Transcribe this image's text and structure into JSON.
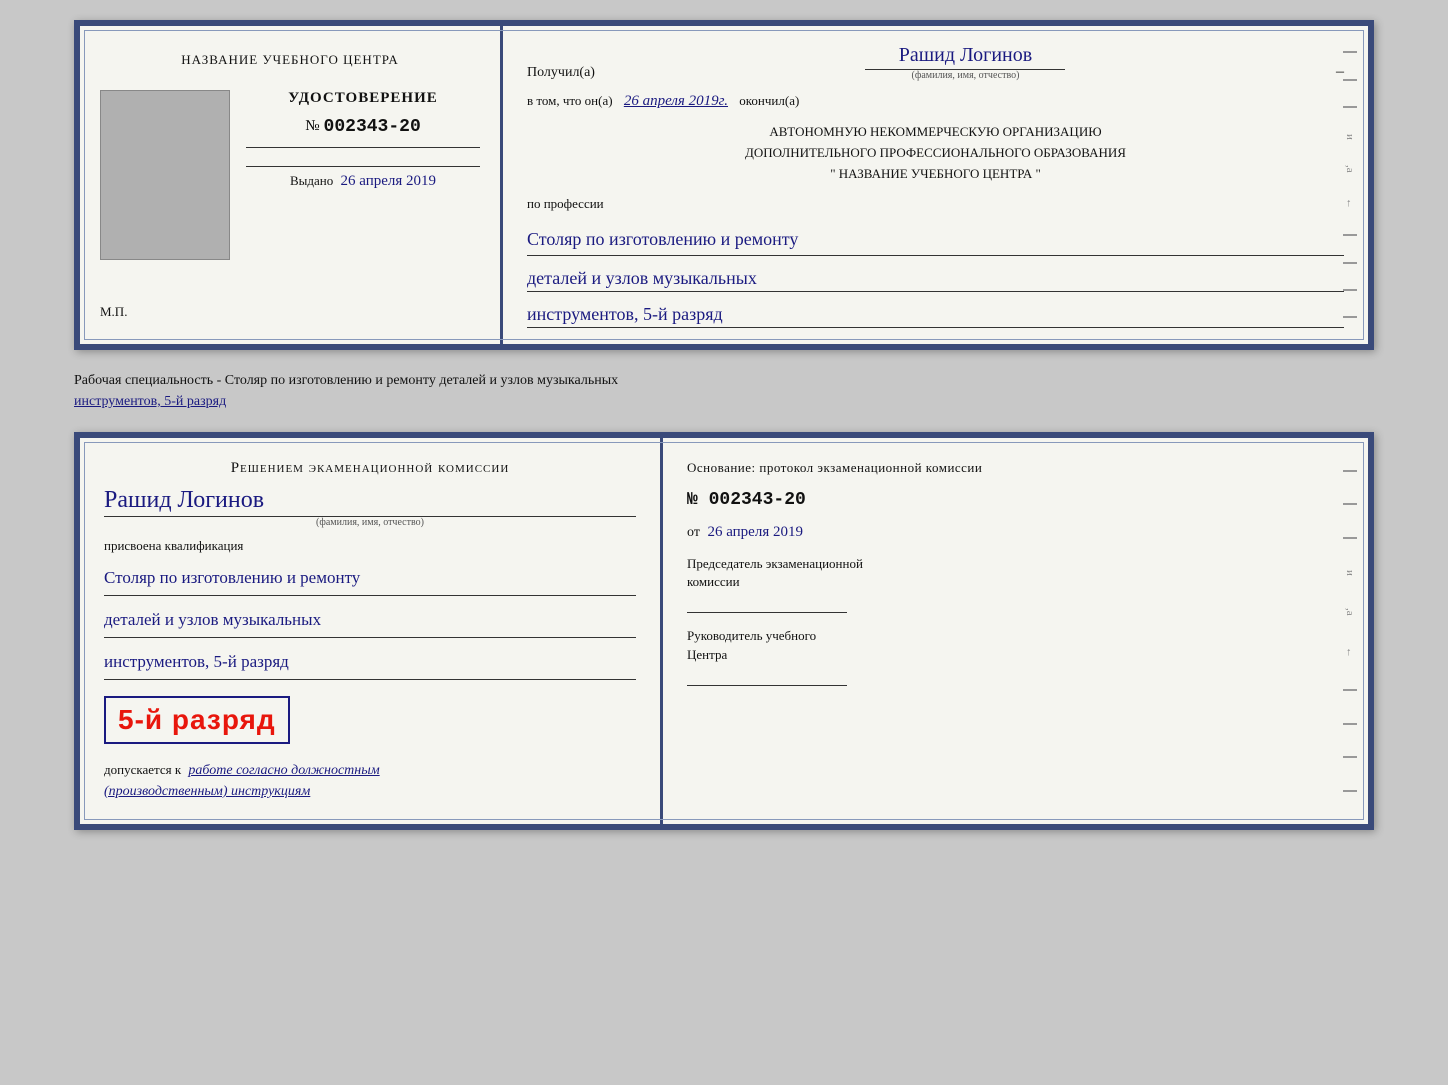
{
  "top_card": {
    "left": {
      "center_name": "НАЗВАНИЕ УЧЕБНОГО ЦЕНТРА",
      "cert_title": "УДОСТОВЕРЕНИЕ",
      "cert_number_prefix": "№",
      "cert_number": "002343-20",
      "issued_label": "Выдано",
      "issued_date": "26 апреля 2019",
      "mp_label": "М.П."
    },
    "right": {
      "received_label": "Получил(а)",
      "recipient_name": "Рашид Логинов",
      "recipient_subtitle": "(фамилия, имя, отчество)",
      "date_prefix": "в том, что он(а)",
      "date_value": "26 апреля 2019г.",
      "date_suffix": "окончил(а)",
      "org_line1": "АВТОНОМНУЮ НЕКОММЕРЧЕСКУЮ ОРГАНИЗАЦИЮ",
      "org_line2": "ДОПОЛНИТЕЛЬНОГО ПРОФЕССИОНАЛЬНОГО ОБРАЗОВАНИЯ",
      "org_line3": "\"    НАЗВАНИЕ УЧЕБНОГО ЦЕНТРА    \"",
      "profession_label": "по профессии",
      "profession_line1": "Столяр по изготовлению и ремонту",
      "profession_line2": "деталей и узлов музыкальных",
      "profession_line3": "инструментов, 5-й разряд"
    }
  },
  "between_label": {
    "text_normal": "Рабочая специальность - Столяр по изготовлению и ремонту деталей и узлов музыкальных",
    "text_underline": "инструментов, 5-й разряд"
  },
  "bottom_card": {
    "left": {
      "decision_title": "Решением экаменационной комиссии",
      "person_name": "Рашид Логинов",
      "person_subtitle": "(фамилия, имя, отчество)",
      "qualification_label": "присвоена квалификация",
      "qual_line1": "Столяр по изготовлению и ремонту",
      "qual_line2": "деталей и узлов музыкальных",
      "qual_line3": "инструментов, 5-й разряд",
      "rank_text": "5-й разряд",
      "допускается_prefix": "допускается к",
      "допускается_italic": "работе согласно должностным",
      "допускается_italic2": "(производственным) инструкциям"
    },
    "right": {
      "basis_label": "Основание: протокол экзаменационной комиссии",
      "protocol_num": "№  002343-20",
      "date_prefix": "от",
      "date_value": "26 апреля 2019",
      "chairman_label": "Председатель экзаменационной\nкомиссии",
      "director_label": "Руководитель учебного\nЦентра"
    }
  }
}
